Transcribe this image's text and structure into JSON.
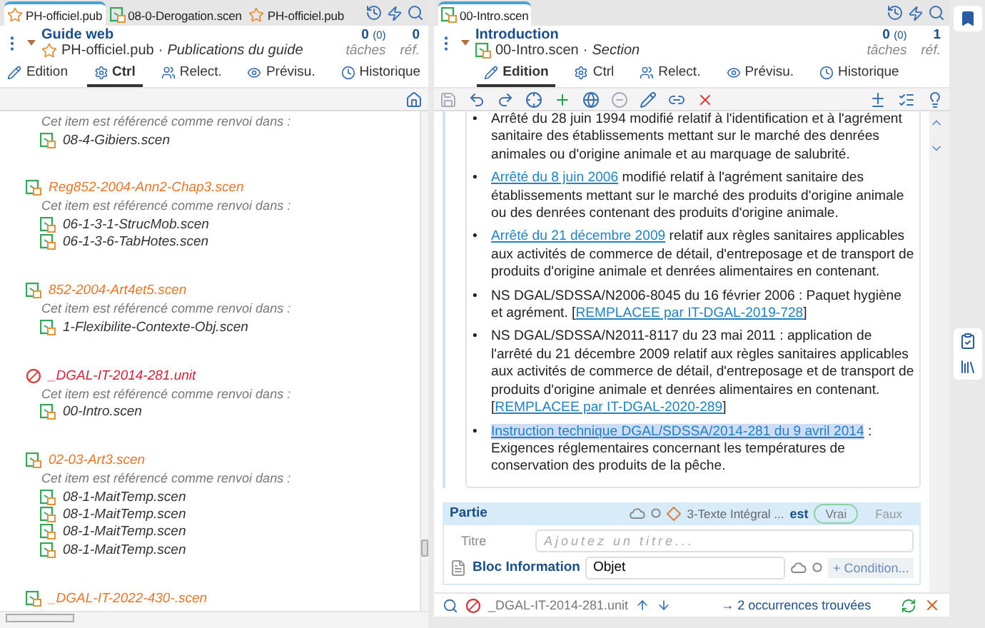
{
  "left": {
    "tabs": [
      {
        "label": "PH-officiel.pub",
        "kind": "pub",
        "selected": true
      },
      {
        "label": "08-0-Derogation.scen",
        "kind": "scen",
        "selected": false
      },
      {
        "label": "PH-officiel.pub",
        "kind": "pub",
        "selected": false
      }
    ],
    "header": {
      "title": "Guide web",
      "file": "PH-officiel.pub",
      "separator": "·",
      "type": "Publications du guide",
      "tasks": "0",
      "tasks_sub": "(0)",
      "tasks_label": "tâches",
      "refs": "0",
      "refs_label": "réf."
    },
    "view_tabs": [
      {
        "label": "Edition",
        "selected": false
      },
      {
        "label": "Ctrl",
        "selected": true
      },
      {
        "label": "Relect.",
        "selected": false
      },
      {
        "label": "Prévisu.",
        "selected": false
      },
      {
        "label": "Historique",
        "selected": false
      }
    ],
    "items": [
      {
        "refs_label": "Cet item est référencé comme renvoi dans :",
        "refs": [
          "08-4-Gibiers.scen"
        ]
      },
      {
        "name": "Reg852-2004-Ann2-Chap3.scen",
        "kind": "scen",
        "refs_label": "Cet item est référencé comme renvoi dans :",
        "refs": [
          "06-1-3-1-StrucMob.scen",
          "06-1-3-6-TabHotes.scen"
        ]
      },
      {
        "name": "852-2004-Art4et5.scen",
        "kind": "scen",
        "refs_label": "Cet item est référencé comme renvoi dans :",
        "refs": [
          "1-Flexibilite-Contexte-Obj.scen"
        ]
      },
      {
        "name": "_DGAL-IT-2014-281.unit",
        "kind": "unit",
        "refs_label": "Cet item est référencé comme renvoi dans :",
        "refs": [
          "00-Intro.scen"
        ]
      },
      {
        "name": "02-03-Art3.scen",
        "kind": "scen",
        "refs_label": "Cet item est référencé comme renvoi dans :",
        "refs": [
          "08-1-MaitTemp.scen",
          "08-1-MaitTemp.scen",
          "08-1-MaitTemp.scen",
          "08-1-MaitTemp.scen"
        ]
      },
      {
        "name": "_DGAL-IT-2022-430-.scen",
        "kind": "scen"
      }
    ]
  },
  "right": {
    "tabs": [
      {
        "label": "00-Intro.scen",
        "kind": "scen",
        "selected": true
      }
    ],
    "header": {
      "title": "Introduction",
      "file": "00-Intro.scen",
      "separator": "·",
      "type": "Section",
      "tasks": "0",
      "tasks_sub": "(0)",
      "tasks_label": "tâches",
      "refs": "1",
      "refs_label": "réf."
    },
    "view_tabs": [
      {
        "label": "Edition",
        "selected": true
      },
      {
        "label": "Ctrl",
        "selected": false
      },
      {
        "label": "Relect.",
        "selected": false
      },
      {
        "label": "Prévisu.",
        "selected": false
      },
      {
        "label": "Historique",
        "selected": false
      }
    ],
    "bullets": [
      {
        "marker": "•",
        "segments": [
          {
            "kind": "plain",
            "text": "Arrêté du 28 juin 1994 modifié relatif à l'identification et à l'agrément sanitaire des établissements mettant sur le marché des denrées animales ou d'origine animale et au marquage de salubrité."
          }
        ]
      },
      {
        "marker": "•",
        "segments": [
          {
            "kind": "link",
            "text": "Arrêté du 8 juin 2006"
          },
          {
            "kind": "plain",
            "text": " modifié relatif à l'agrément sanitaire des établissements mettant sur le marché des produits d'origine animale ou des denrées contenant des produits d'origine animale."
          }
        ]
      },
      {
        "marker": "•",
        "segments": [
          {
            "kind": "link",
            "text": "Arrêté du 21 décembre 2009"
          },
          {
            "kind": "plain",
            "text": " relatif aux règles sanitaires applicables aux activités de commerce de détail, d'entreposage et de transport de produits d'origine animale et denrées alimentaires en contenant."
          }
        ]
      },
      {
        "marker": "•",
        "segments": [
          {
            "kind": "plain",
            "text": "NS DGAL/SDSSA/N2006-8045 du 16 février 2006 : Paquet hygiène et agrément. ["
          },
          {
            "kind": "link",
            "text": "REMPLACEE par IT-DGAL-2019-728"
          },
          {
            "kind": "plain",
            "text": "]"
          }
        ]
      },
      {
        "marker": "•",
        "segments": [
          {
            "kind": "plain",
            "text": "NS DGAL/SDSSA/N2011-8117 du 23 mai 2011 : application de l'arrêté du 21 décembre 2009 relatif aux règles sanitaires applicables aux activités de commerce de détail, d'entreposage et de transport de produits d'origine animale et denrées alimentaires en contenant. ["
          },
          {
            "kind": "link",
            "text": "REMPLACEE par IT-DGAL-2020-289"
          },
          {
            "kind": "plain",
            "text": "]"
          }
        ]
      },
      {
        "marker": "•",
        "segments": [
          {
            "kind": "match",
            "text": "Instruction technique DGAL/SDSSA/2014-281 du 9 avril 2014"
          },
          {
            "kind": "plain",
            "text": " : Exigences réglementaires concernant les températures de conservation des produits de la pêche."
          }
        ]
      }
    ],
    "part": {
      "title": "Partie",
      "condition": "3-Texte Intégral ...",
      "is_label": "est",
      "options": [
        {
          "label": "Vrai",
          "selected": true
        },
        {
          "label": "Faux",
          "selected": false
        }
      ],
      "title_label": "Titre",
      "title_placeholder": "Ajoutez un titre...",
      "block_label": "Bloc Information",
      "block_value": "Objet",
      "condition_button": "+ Condition..."
    },
    "search": {
      "item": "_DGAL-IT-2014-281.unit",
      "result": "→ 2 occurrences trouvées"
    }
  }
}
